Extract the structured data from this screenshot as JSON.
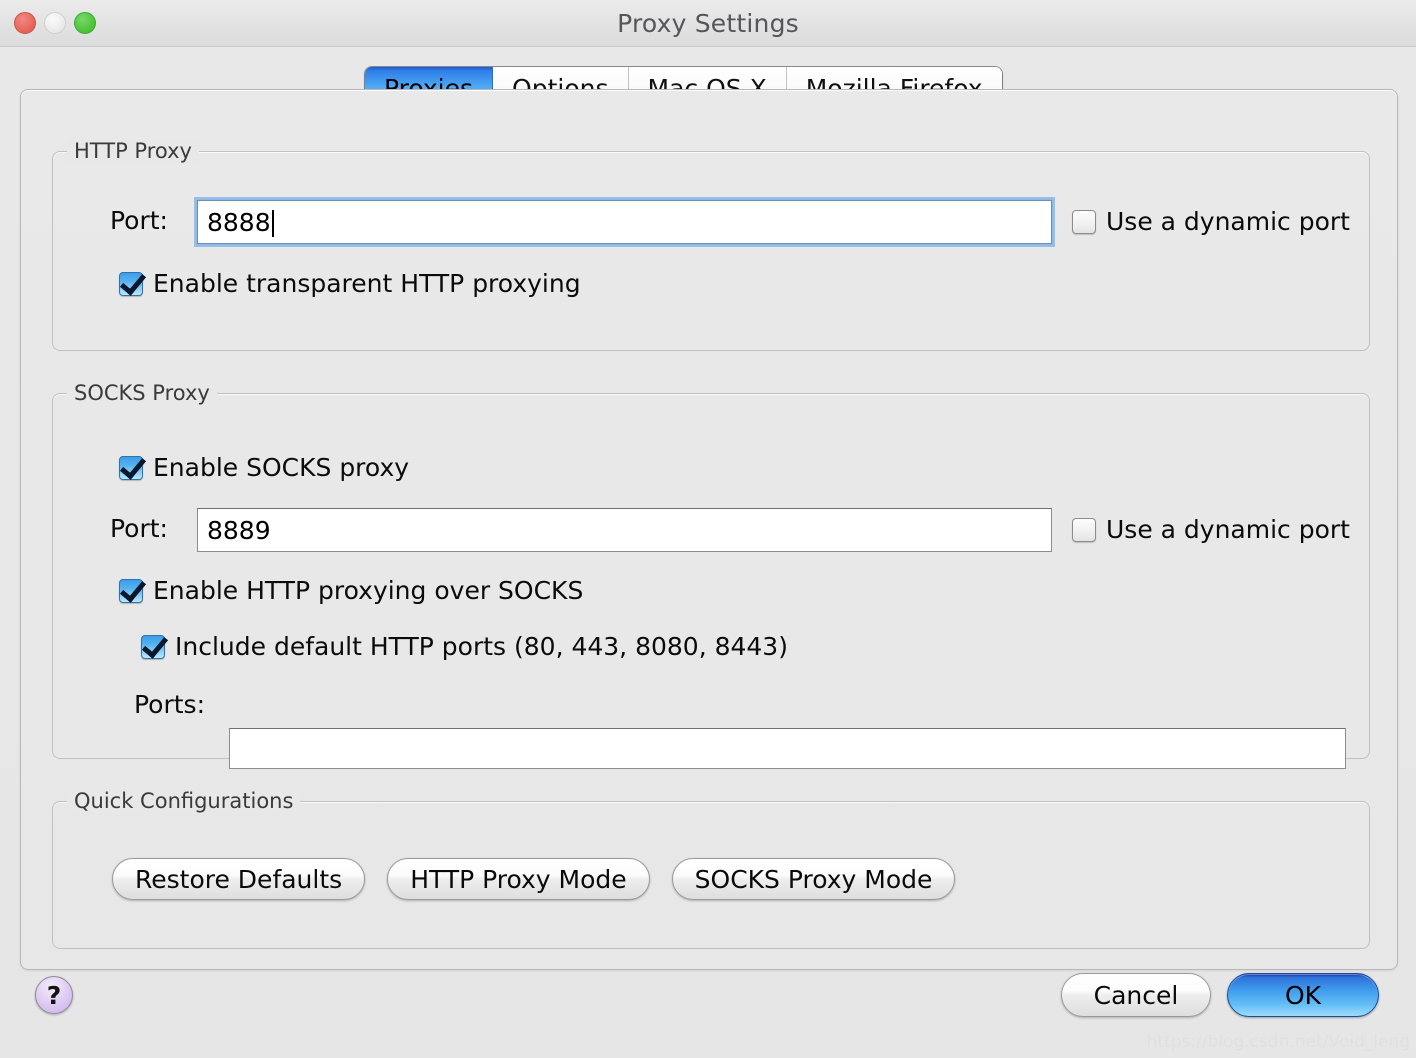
{
  "window": {
    "title": "Proxy Settings",
    "traffic_lights": [
      "close-red",
      "minimize-gray",
      "zoom-green"
    ]
  },
  "tabs": [
    {
      "label": "Proxies",
      "selected": true
    },
    {
      "label": "Options",
      "selected": false
    },
    {
      "label": "Mac OS X",
      "selected": false
    },
    {
      "label": "Mozilla Firefox",
      "selected": false
    }
  ],
  "http_proxy": {
    "group_title": "HTTP Proxy",
    "port_label": "Port:",
    "port_value": "8888",
    "port_focused": true,
    "dynamic_port_label": "Use a dynamic port",
    "dynamic_port_checked": false,
    "transparent_label": "Enable transparent HTTP proxying",
    "transparent_checked": true
  },
  "socks_proxy": {
    "group_title": "SOCKS Proxy",
    "enable_label": "Enable SOCKS proxy",
    "enable_checked": true,
    "port_label": "Port:",
    "port_value": "8889",
    "dynamic_port_label": "Use a dynamic port",
    "dynamic_port_checked": false,
    "http_over_socks_label": "Enable HTTP proxying over SOCKS",
    "http_over_socks_checked": true,
    "include_default_label": "Include default HTTP ports (80, 443, 8080, 8443)",
    "include_default_checked": true,
    "ports_label": "Ports:",
    "ports_value": "",
    "ports_placeholder": ""
  },
  "quick_configurations": {
    "group_title": "Quick Configurations",
    "buttons": [
      "Restore Defaults",
      "HTTP Proxy Mode",
      "SOCKS Proxy Mode"
    ]
  },
  "footer": {
    "help_label": "?",
    "cancel_label": "Cancel",
    "ok_label": "OK"
  },
  "watermark": "https://blog.csdn.net/Void_leng",
  "colors": {
    "accent_blue": "#3f9ced",
    "selected_tab_blue": "#4ba4f2",
    "window_bg": "#e8e8e8",
    "close_red": "#e8675c",
    "zoom_green": "#4fc53c",
    "help_purple": "#ddc9f3"
  }
}
